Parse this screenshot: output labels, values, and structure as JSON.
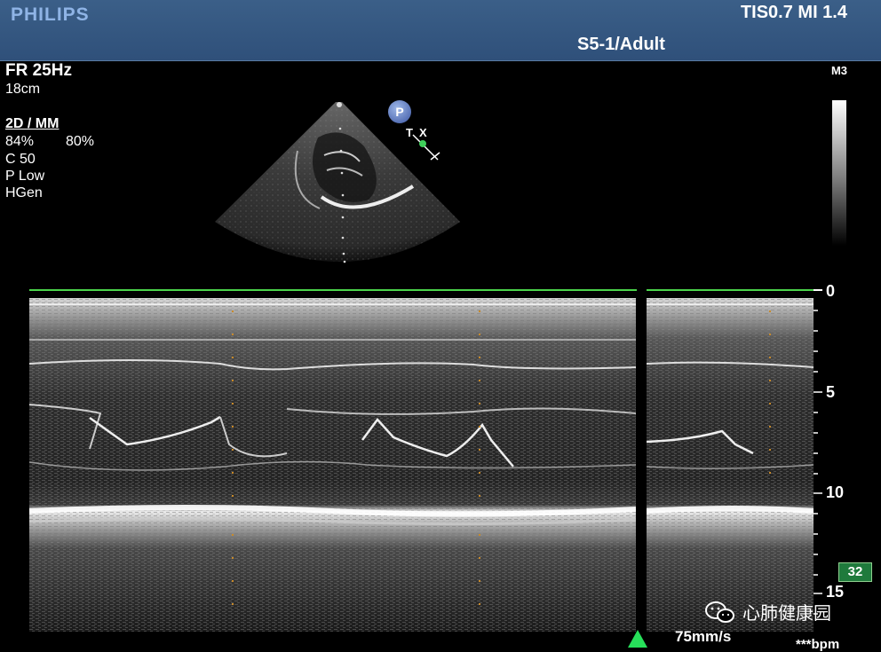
{
  "header": {
    "brand": "PHILIPS",
    "tis_mi": "TIS0.7   MI 1.4",
    "probe_preset": "S5-1/Adult"
  },
  "left_info": {
    "frame_rate": "FR 25Hz",
    "depth": "18cm",
    "mode": "2D / MM",
    "gain_2d": " 84%",
    "gain_mm": "80%",
    "compression": "C 50",
    "persistence": "P Low",
    "harmonic": "HGen"
  },
  "map": {
    "label": "M3"
  },
  "transducer": {
    "p_label": "P"
  },
  "depth_scale": {
    "labels": [
      "0",
      "5",
      "10",
      "15"
    ]
  },
  "footer": {
    "sweep_speed": "75mm/s",
    "heart_rate": "***bpm",
    "badge_value": "32",
    "watermark": "心肺健康园"
  },
  "colors": {
    "header_bg": "#2f507a",
    "marker_green": "#4bd34b",
    "badge_green": "#1f7a3c"
  }
}
